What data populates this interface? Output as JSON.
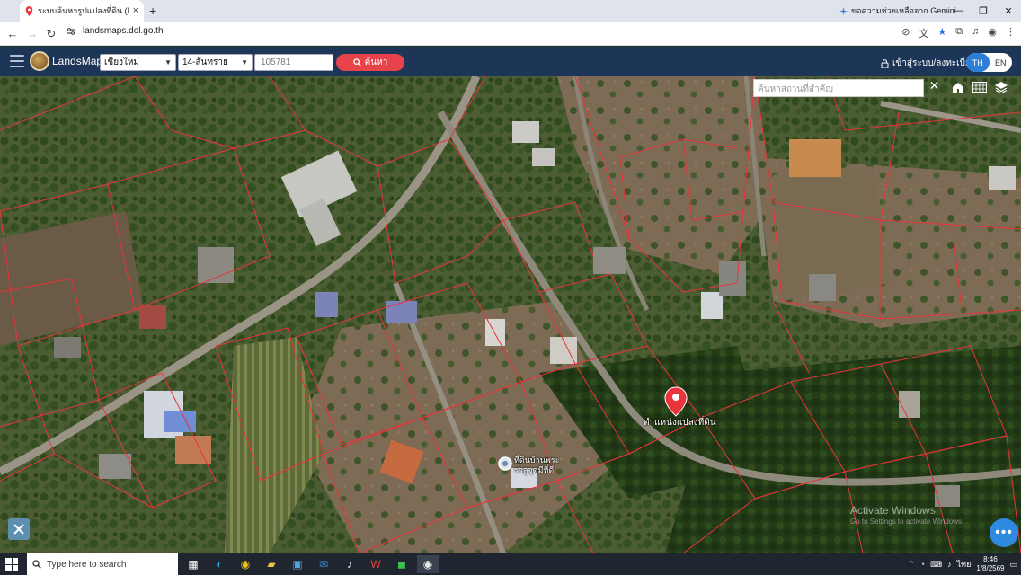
{
  "browser": {
    "tab_title": "ระบบค้นหารูปแปลงที่ดิน (LandsMa",
    "new_tab_symbol": "+",
    "tab_close_symbol": "×",
    "url": "landsmaps.dol.go.th",
    "gemini_label": "ขอความช่วยเหลือจาก Gemini",
    "window_buttons": [
      "—",
      "❐",
      "✕"
    ]
  },
  "app": {
    "brand": "LandsMaps",
    "province_select": "เชียงใหม่",
    "district_select": "14-สันทราย",
    "parcel_number": "105781",
    "search_button": "ค้นหา",
    "login_label": "เข้าสู่ระบบ/ลงทะเบียน",
    "lang_th": "TH",
    "lang_en": "EN"
  },
  "map": {
    "search_placeholder": "ค้นหาสถานที่สำคัญ",
    "close_symbol": "✕",
    "pin_label": "ตำแหน่งแปลงที่ดิน",
    "poi_label": "ที่ดินบ้านพระ รวลูจุดมีที่ดี",
    "watermark_title": "Activate Windows",
    "watermark_sub": "Go to Settings to activate Windows.",
    "fab_symbol": "•••",
    "colors": {
      "parcel_line": "#e8343a",
      "pin": "#e8343a",
      "header": "#1d3557",
      "search_button": "#e8434a"
    }
  },
  "taskbar": {
    "search_placeholder": "Type here to search",
    "time": "8:46",
    "date": "1/8/2569",
    "language": "ไทย"
  }
}
